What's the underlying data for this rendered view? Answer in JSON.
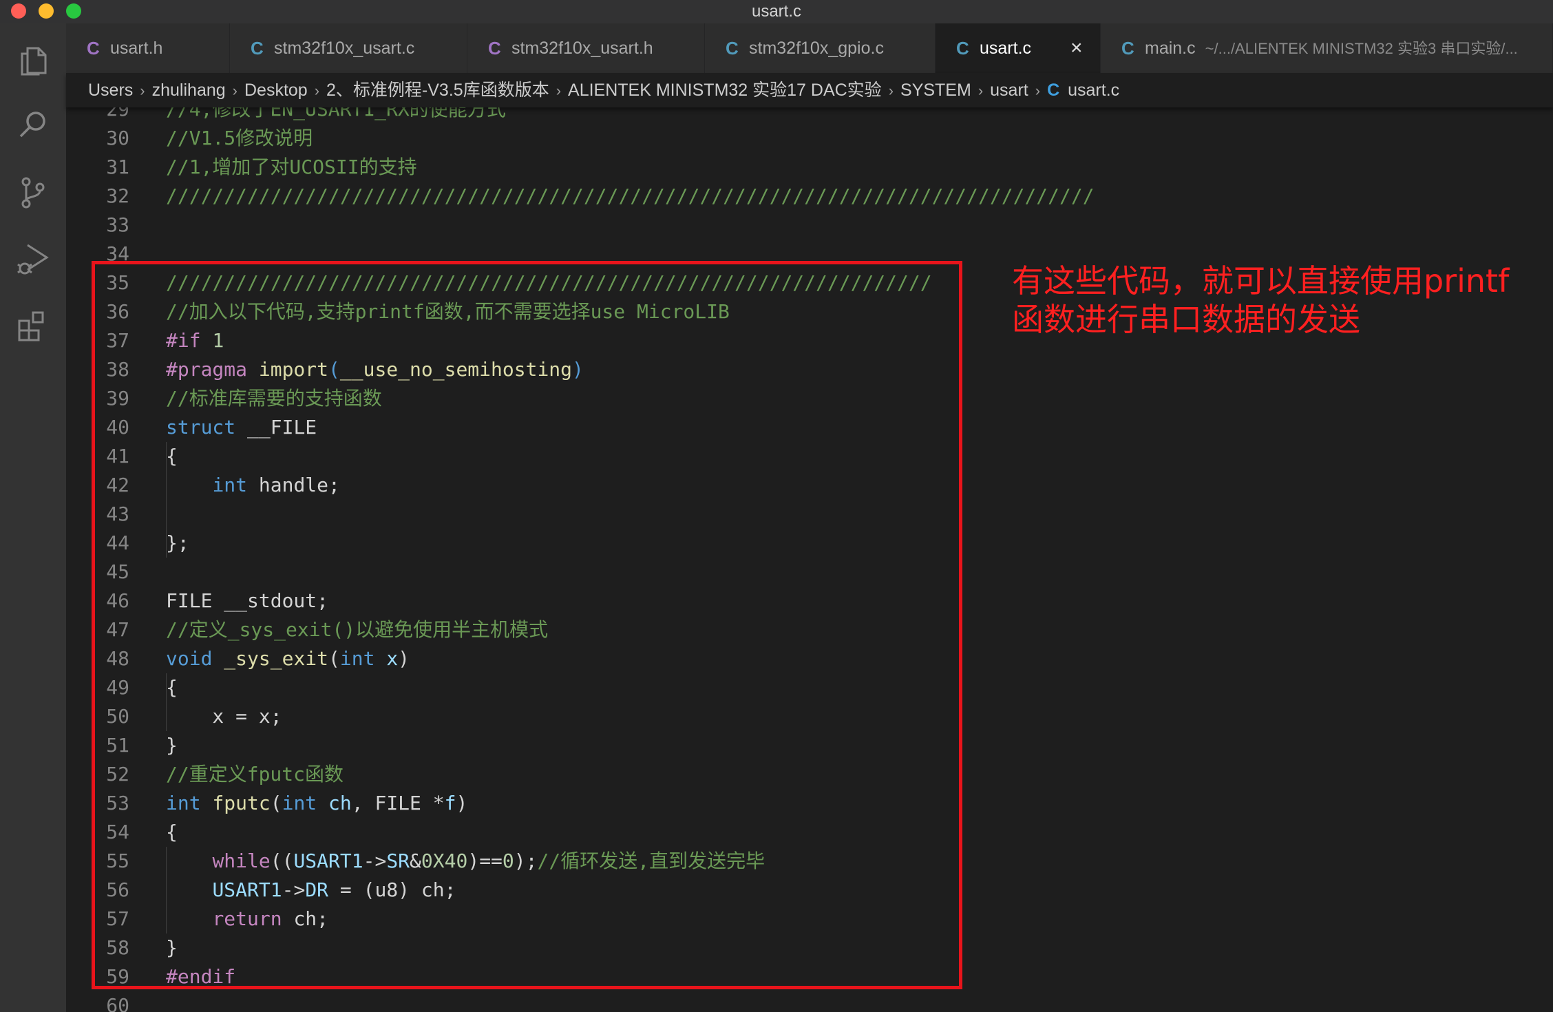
{
  "window": {
    "title": "usart.c",
    "controls": {
      "close_color": "#ff5f57",
      "minimize_color": "#febc2e",
      "maximize_color": "#28c840"
    }
  },
  "activity_bar": {
    "icons": [
      "explorer-icon",
      "search-icon",
      "source-control-icon",
      "run-debug-icon",
      "extensions-icon"
    ]
  },
  "tabs": [
    {
      "icon": "C",
      "icon_color": "#a074c4",
      "label": "usart.h",
      "path": ""
    },
    {
      "icon": "C",
      "icon_color": "#519aba",
      "label": "stm32f10x_usart.c",
      "path": ""
    },
    {
      "icon": "C",
      "icon_color": "#a074c4",
      "label": "stm32f10x_usart.h",
      "path": ""
    },
    {
      "icon": "C",
      "icon_color": "#519aba",
      "label": "stm32f10x_gpio.c",
      "path": ""
    },
    {
      "icon": "C",
      "icon_color": "#519aba",
      "label": "usart.c",
      "path": "",
      "active": true,
      "close": "×"
    },
    {
      "icon": "C",
      "icon_color": "#519aba",
      "label": "main.c",
      "path": "~/.../ALIENTEK MINISTM32 实验3 串口实验/..."
    }
  ],
  "breadcrumbs": {
    "items": [
      "Users",
      "zhulihang",
      "Desktop",
      "2、标准例程-V3.5库函数版本",
      "ALIENTEK MINISTM32 实验17 DAC实验",
      "SYSTEM",
      "usart"
    ],
    "file_icon": "C",
    "file": "usart.c",
    "separator": "›"
  },
  "editor": {
    "lines": [
      {
        "n": "29",
        "t": [
          [
            "cm",
            "//4,修改了EN_USART1_RX的使能方式"
          ]
        ]
      },
      {
        "n": "30",
        "t": [
          [
            "cm",
            "//V1.5修改说明"
          ]
        ]
      },
      {
        "n": "31",
        "t": [
          [
            "cm",
            "//1,增加了对UCOSII的支持"
          ]
        ]
      },
      {
        "n": "32",
        "t": [
          [
            "cm",
            "////////////////////////////////////////////////////////////////////////////////"
          ]
        ]
      },
      {
        "n": "33",
        "t": []
      },
      {
        "n": "34",
        "t": []
      },
      {
        "n": "35",
        "t": [
          [
            "cm",
            "//////////////////////////////////////////////////////////////////"
          ]
        ]
      },
      {
        "n": "36",
        "t": [
          [
            "cm",
            "//加入以下代码,支持printf函数,而不需要选择use MicroLIB"
          ]
        ]
      },
      {
        "n": "37",
        "t": [
          [
            "pp",
            "#if "
          ],
          [
            "nu",
            "1"
          ]
        ]
      },
      {
        "n": "38",
        "t": [
          [
            "pp",
            "#pragma "
          ],
          [
            "fn",
            "import"
          ],
          [
            "brk",
            "("
          ],
          [
            "fn",
            "__use_no_semihosting"
          ],
          [
            "brk",
            ")"
          ]
        ]
      },
      {
        "n": "39",
        "t": [
          [
            "cm",
            "//标准库需要的支持函数"
          ]
        ]
      },
      {
        "n": "40",
        "t": [
          [
            "kw",
            "struct "
          ],
          [
            "pl",
            "__FILE"
          ]
        ]
      },
      {
        "n": "41",
        "t": [
          [
            "pl",
            "{"
          ]
        ]
      },
      {
        "n": "42",
        "t": [
          [
            "pl",
            "    "
          ],
          [
            "kw",
            "int "
          ],
          [
            "pl",
            "handle;"
          ]
        ]
      },
      {
        "n": "43",
        "t": []
      },
      {
        "n": "44",
        "t": [
          [
            "pl",
            "};"
          ]
        ]
      },
      {
        "n": "45",
        "t": []
      },
      {
        "n": "46",
        "t": [
          [
            "pl",
            "FILE __stdout;"
          ]
        ]
      },
      {
        "n": "47",
        "t": [
          [
            "cm",
            "//定义_sys_exit()以避免使用半主机模式"
          ]
        ]
      },
      {
        "n": "48",
        "t": [
          [
            "kw",
            "void "
          ],
          [
            "fn",
            "_sys_exit"
          ],
          [
            "pl",
            "("
          ],
          [
            "kw",
            "int "
          ],
          [
            "vr",
            "x"
          ],
          [
            "pl",
            ")"
          ]
        ]
      },
      {
        "n": "49",
        "t": [
          [
            "pl",
            "{"
          ]
        ]
      },
      {
        "n": "50",
        "t": [
          [
            "pl",
            "    x = x;"
          ]
        ]
      },
      {
        "n": "51",
        "t": [
          [
            "pl",
            "}"
          ]
        ]
      },
      {
        "n": "52",
        "t": [
          [
            "cm",
            "//重定义fputc函数"
          ]
        ]
      },
      {
        "n": "53",
        "t": [
          [
            "kw",
            "int "
          ],
          [
            "fn",
            "fputc"
          ],
          [
            "pl",
            "("
          ],
          [
            "kw",
            "int "
          ],
          [
            "vr",
            "ch"
          ],
          [
            "pl",
            ", FILE *"
          ],
          [
            "vr",
            "f"
          ],
          [
            "pl",
            ")"
          ]
        ]
      },
      {
        "n": "54",
        "t": [
          [
            "pl",
            "{"
          ]
        ]
      },
      {
        "n": "55",
        "t": [
          [
            "pl",
            "    "
          ],
          [
            "pp",
            "while"
          ],
          [
            "pl",
            "(("
          ],
          [
            "vr",
            "USART1"
          ],
          [
            "pl",
            "->"
          ],
          [
            "vr",
            "SR"
          ],
          [
            "pl",
            "&"
          ],
          [
            "nu",
            "0X40"
          ],
          [
            "pl",
            ")=="
          ],
          [
            "nu",
            "0"
          ],
          [
            "pl",
            ");"
          ],
          [
            "cm",
            "//循环发送,直到发送完毕"
          ]
        ]
      },
      {
        "n": "56",
        "t": [
          [
            "pl",
            "    "
          ],
          [
            "vr",
            "USART1"
          ],
          [
            "pl",
            "->"
          ],
          [
            "vr",
            "DR"
          ],
          [
            "pl",
            " = (u8) ch;"
          ]
        ]
      },
      {
        "n": "57",
        "t": [
          [
            "pl",
            "    "
          ],
          [
            "pp",
            "return "
          ],
          [
            "pl",
            "ch;"
          ]
        ]
      },
      {
        "n": "58",
        "t": [
          [
            "pl",
            "}"
          ]
        ]
      },
      {
        "n": "59",
        "t": [
          [
            "pp",
            "#endif"
          ]
        ]
      },
      {
        "n": "60",
        "t": []
      }
    ]
  },
  "annotation": {
    "text": "有这些代码，就可以直接使用printf函数进行串口数据的发送",
    "color": "#ff2020",
    "box_color": "#e8141b"
  }
}
